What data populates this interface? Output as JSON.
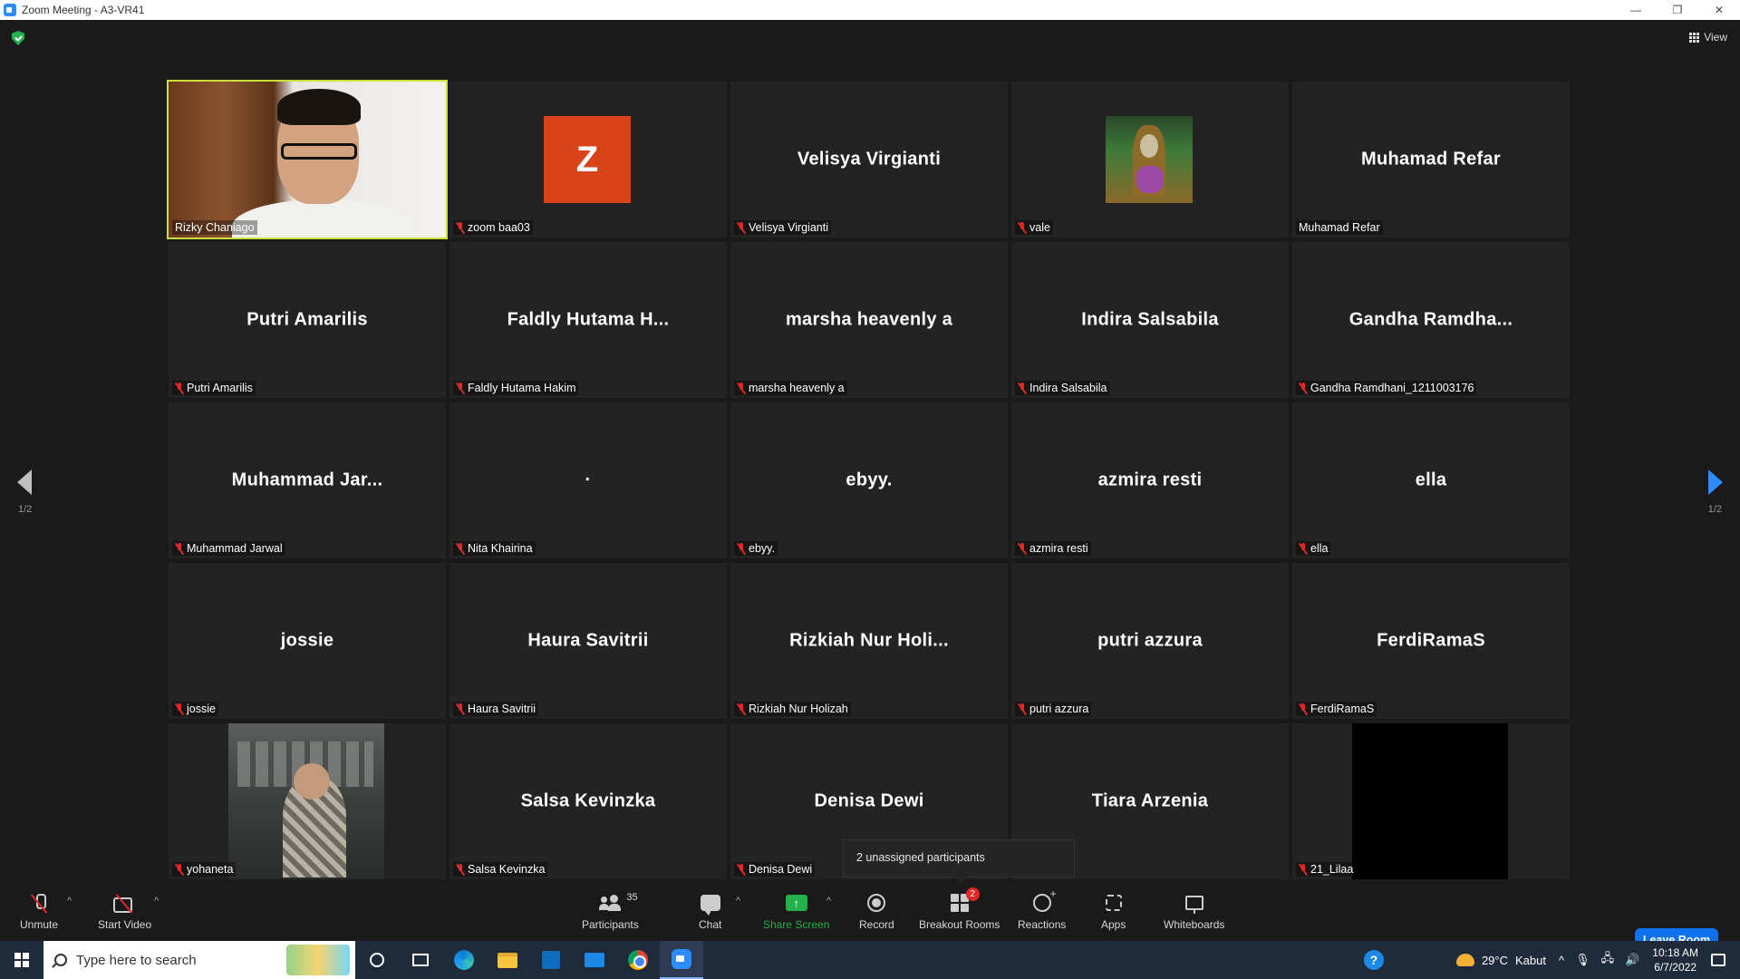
{
  "window": {
    "title": "Zoom Meeting - A3-VR41",
    "minimize": "—",
    "restore": "❐",
    "close": "✕"
  },
  "meeting": {
    "view_label": "View",
    "page_left": "1/2",
    "page_right": "1/2",
    "tooltip": "2 unassigned participants"
  },
  "tiles": [
    {
      "big": "",
      "label": "Rizky Chaniago",
      "muted": false,
      "kind": "video-person",
      "active": true
    },
    {
      "big": "",
      "label": "zoom baa03",
      "muted": true,
      "kind": "avatar-z",
      "avatar_letter": "Z"
    },
    {
      "big": "Velisya Virgianti",
      "label": "Velisya Virgianti",
      "muted": true,
      "kind": "name"
    },
    {
      "big": "",
      "label": "vale",
      "muted": true,
      "kind": "avatar-pic"
    },
    {
      "big": "Muhamad Refar",
      "label": "Muhamad Refar",
      "muted": false,
      "kind": "name"
    },
    {
      "big": "Putri Amarilis",
      "label": "Putri Amarilis",
      "muted": true,
      "kind": "name"
    },
    {
      "big": "Faldly Hutama H...",
      "label": "Faldly Hutama Hakim",
      "muted": true,
      "kind": "name"
    },
    {
      "big": "marsha heavenly a",
      "label": "marsha heavenly a",
      "muted": true,
      "kind": "name"
    },
    {
      "big": "Indira Salsabila",
      "label": "Indira Salsabila",
      "muted": true,
      "kind": "name"
    },
    {
      "big": "Gandha Ramdha...",
      "label": "Gandha Ramdhani_1211003176",
      "muted": true,
      "kind": "name"
    },
    {
      "big": "Muhammad Jar...",
      "label": "Muhammad Jarwal",
      "muted": true,
      "kind": "name"
    },
    {
      "big": "·",
      "label": "Nita Khairina",
      "muted": true,
      "kind": "name"
    },
    {
      "big": "ebyy.",
      "label": "ebyy.",
      "muted": true,
      "kind": "name"
    },
    {
      "big": "azmira resti",
      "label": "azmira resti",
      "muted": true,
      "kind": "name"
    },
    {
      "big": "ella",
      "label": "ella",
      "muted": true,
      "kind": "name"
    },
    {
      "big": "jossie",
      "label": "jossie",
      "muted": true,
      "kind": "name"
    },
    {
      "big": "Haura Savitrii",
      "label": "Haura Savitrii",
      "muted": true,
      "kind": "name"
    },
    {
      "big": "Rizkiah Nur Holi...",
      "label": "Rizkiah Nur Holizah",
      "muted": true,
      "kind": "name"
    },
    {
      "big": "putri azzura",
      "label": "putri azzura",
      "muted": true,
      "kind": "name"
    },
    {
      "big": "FerdiRamaS",
      "label": "FerdiRamaS",
      "muted": true,
      "kind": "name"
    },
    {
      "big": "",
      "label": "yohaneta",
      "muted": true,
      "kind": "video-boy"
    },
    {
      "big": "Salsa Kevinzka",
      "label": "Salsa Kevinzka",
      "muted": true,
      "kind": "name"
    },
    {
      "big": "Denisa Dewi",
      "label": "Denisa Dewi",
      "muted": true,
      "kind": "name"
    },
    {
      "big": "Tiara Arzenia",
      "label": "zenia",
      "muted": false,
      "kind": "name"
    },
    {
      "big": "",
      "label": "21_Lilaa",
      "muted": true,
      "kind": "video-dark"
    }
  ],
  "toolbar": {
    "unmute": "Unmute",
    "start_video": "Start Video",
    "participants": "Participants",
    "participants_count": "35",
    "chat": "Chat",
    "share_screen": "Share Screen",
    "record": "Record",
    "breakout_rooms": "Breakout Rooms",
    "breakout_badge": "2",
    "reactions": "Reactions",
    "apps": "Apps",
    "whiteboards": "Whiteboards",
    "leave": "Leave Room",
    "caret": "^"
  },
  "taskbar": {
    "search_placeholder": "Type here to search",
    "help": "?",
    "temperature": "29°C",
    "weather": "Kabut",
    "tray_chevron": "^",
    "time": "10:18 AM",
    "date": "6/7/2022"
  }
}
